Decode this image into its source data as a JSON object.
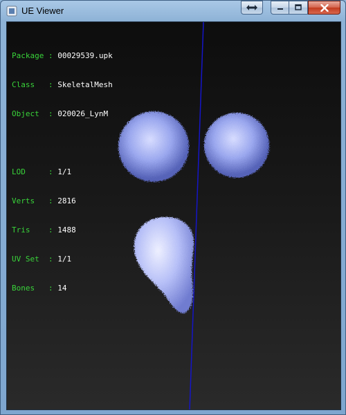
{
  "window": {
    "title": "UE Viewer",
    "controls": {
      "switch": "switch-view",
      "minimize": "minimize",
      "maximize": "maximize",
      "close": "close"
    }
  },
  "info": {
    "package_label": "Package",
    "package_value": "00029539.upk",
    "class_label": "Class",
    "class_value": "SkeletalMesh",
    "object_label": "Object",
    "object_value": "020026_LynM",
    "lod_label": "LOD",
    "lod_value": "1/1",
    "verts_label": "Verts",
    "verts_value": "2816",
    "tris_label": "Tris",
    "tris_value": "1488",
    "uvset_label": "UV Set",
    "uvset_value": "1/1",
    "bones_label": "Bones",
    "bones_value": "14",
    "separator": ":"
  },
  "colors": {
    "label": "#39d43a",
    "value": "#ffffff",
    "axis": "#1515c8",
    "mesh": "#a9b4f5"
  }
}
